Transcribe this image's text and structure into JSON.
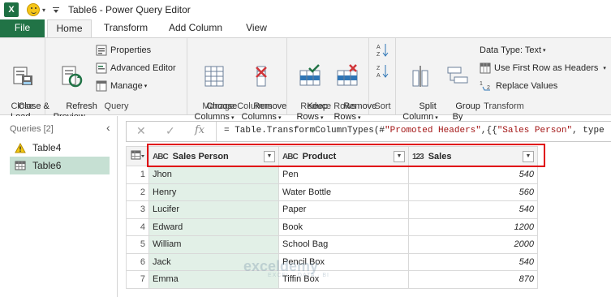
{
  "window": {
    "title": "Table6 - Power Query Editor"
  },
  "tabs": [
    {
      "label": "File"
    },
    {
      "label": "Home"
    },
    {
      "label": "Transform"
    },
    {
      "label": "Add Column"
    },
    {
      "label": "View"
    }
  ],
  "ribbon": {
    "close": {
      "button": "Close &\nLoad",
      "group": "Close"
    },
    "query": {
      "refresh": "Refresh\nPreview",
      "properties": "Properties",
      "advanced_editor": "Advanced Editor",
      "manage": "Manage",
      "group": "Query"
    },
    "manage_columns": {
      "choose": "Choose\nColumns",
      "remove": "Remove\nColumns",
      "group": "Manage Columns"
    },
    "reduce_rows": {
      "keep": "Keep\nRows",
      "remove": "Remove\nRows",
      "group": "Reduce Rows"
    },
    "sort": {
      "group": "Sort"
    },
    "transform": {
      "split": "Split\nColumn",
      "group_by": "Group\nBy",
      "data_type": "Data Type: Text",
      "first_row": "Use First Row as Headers",
      "replace": "Replace Values",
      "group": "Transform"
    }
  },
  "queries": {
    "header": "Queries [2]",
    "items": [
      {
        "label": "Table4",
        "icon": "warning-icon",
        "selected": false
      },
      {
        "label": "Table6",
        "icon": "table-icon",
        "selected": true
      }
    ]
  },
  "formula": {
    "prefix": "= Table.TransformColumnTypes(#",
    "str1": "\"Promoted Headers\"",
    "mid": ",{{",
    "str2": "\"Sales Person\"",
    "suffix": ", type"
  },
  "grid": {
    "columns": [
      {
        "type": "ABC",
        "name": "Sales Person"
      },
      {
        "type": "ABC",
        "name": "Product"
      },
      {
        "type": "123",
        "name": "Sales"
      }
    ],
    "rows": [
      {
        "n": "1",
        "person": "Jhon",
        "product": "Pen",
        "sales": "540"
      },
      {
        "n": "2",
        "person": "Henry",
        "product": "Water Bottle",
        "sales": "560"
      },
      {
        "n": "3",
        "person": "Lucifer",
        "product": "Paper",
        "sales": "540"
      },
      {
        "n": "4",
        "person": "Edward",
        "product": "Book",
        "sales": "1200"
      },
      {
        "n": "5",
        "person": "William",
        "product": "School Bag",
        "sales": "2000"
      },
      {
        "n": "6",
        "person": "Jack",
        "product": "Pencil Box",
        "sales": "540"
      },
      {
        "n": "7",
        "person": "Emma",
        "product": "Tiffin Box",
        "sales": "870"
      }
    ]
  },
  "watermark": {
    "name": "exceldemy",
    "tagline": "EXCEL · DATA · BI"
  },
  "colors": {
    "accent": "#217346",
    "highlight": "#e0000b",
    "selected_column": "#e2f0e7"
  }
}
